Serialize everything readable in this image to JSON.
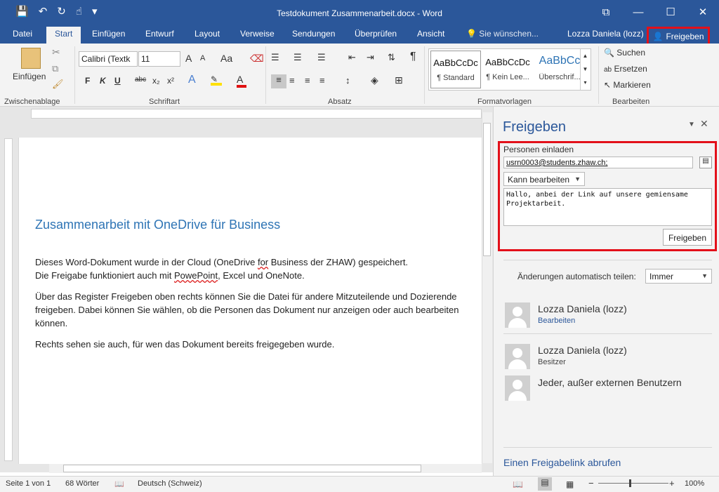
{
  "window": {
    "title": "Testdokument Zusammenarbeit.docx - Word",
    "controls": {
      "ribbon_opts": "⧉",
      "minimize": "—",
      "maximize": "☐",
      "close": "✕"
    }
  },
  "qat": {
    "save_icon": "💾",
    "undo_icon": "↶",
    "redo_icon": "↻",
    "touch_icon": "☝",
    "customize_icon": "▾"
  },
  "tabs": {
    "datei": "Datei",
    "start": "Start",
    "einfuegen": "Einfügen",
    "entwurf": "Entwurf",
    "layout": "Layout",
    "verweise": "Verweise",
    "sendungen": "Sendungen",
    "ueberpruefen": "Überprüfen",
    "ansicht": "Ansicht",
    "tellme": "Sie wünschen..."
  },
  "user": {
    "name": "Lozza Daniela (lozz)",
    "share_label": "Freigeben"
  },
  "ribbon": {
    "clipboard": {
      "paste_label": "Einfügen",
      "group": "Zwischenablage"
    },
    "font": {
      "family": "Calibri (Textk",
      "size": "11",
      "group": "Schriftart",
      "bold": "F",
      "italic": "K",
      "underline": "U",
      "strike": "abc",
      "sub": "x₂",
      "sup": "x²",
      "grow": "A",
      "shrink": "A",
      "case": "Aa"
    },
    "paragraph": {
      "group": "Absatz",
      "pilcrow": "¶"
    },
    "styles": {
      "group": "Formatvorlagen",
      "items": [
        {
          "sample": "AaBbCcDc",
          "name": "¶ Standard"
        },
        {
          "sample": "AaBbCcDc",
          "name": "¶ Kein Lee..."
        },
        {
          "sample": "AaBbCc",
          "name": "Überschrif..."
        }
      ]
    },
    "editing": {
      "group": "Bearbeiten",
      "find": "Suchen",
      "replace": "Ersetzen",
      "select": "Markieren"
    }
  },
  "document": {
    "heading": "Zusammenarbeit mit OneDrive für Business",
    "p1a": "Dieses Word-Dokument wurde in der Cloud (OneDrive ",
    "p1_for": "for",
    "p1b": " Business der ZHAW) gespeichert.",
    "p2a": "Die Freigabe funktioniert auch mit ",
    "p2_pp": "PowePoint",
    "p2b": ", Excel und OneNote.",
    "p3": "Über das Register Freigeben oben rechts können Sie die Datei für andere Mitzuteilende und Dozierende freigeben. Dabei können Sie wählen, ob die Personen das Dokument nur anzeigen oder auch bearbeiten können.",
    "p4": "Rechts sehen sie auch, für wen das Dokument bereits freigegeben wurde."
  },
  "share_pane": {
    "title": "Freigeben",
    "invite_label": "Personen einladen",
    "email_value": "usrn0003@students.zhaw.ch;",
    "permission": "Kann bearbeiten",
    "message": "Hallo, anbei der Link auf unsere gemiensame Projektarbeit.",
    "share_button": "Freigeben",
    "auto_share_label": "Änderungen automatisch teilen:",
    "auto_share_value": "Immer",
    "people": [
      {
        "name": "Lozza Daniela (lozz)",
        "role": "Bearbeiten"
      },
      {
        "name": "Lozza Daniela (lozz)",
        "role": "Besitzer"
      },
      {
        "name": "Jeder, außer externen Benutzern",
        "role": ""
      }
    ],
    "link_label": "Einen Freigabelink abrufen"
  },
  "status": {
    "page": "Seite 1 von 1",
    "words": "68 Wörter",
    "language": "Deutsch (Schweiz)",
    "zoom": "100%"
  },
  "colors": {
    "brand": "#2b579a",
    "highlight_border": "#e3101a"
  }
}
